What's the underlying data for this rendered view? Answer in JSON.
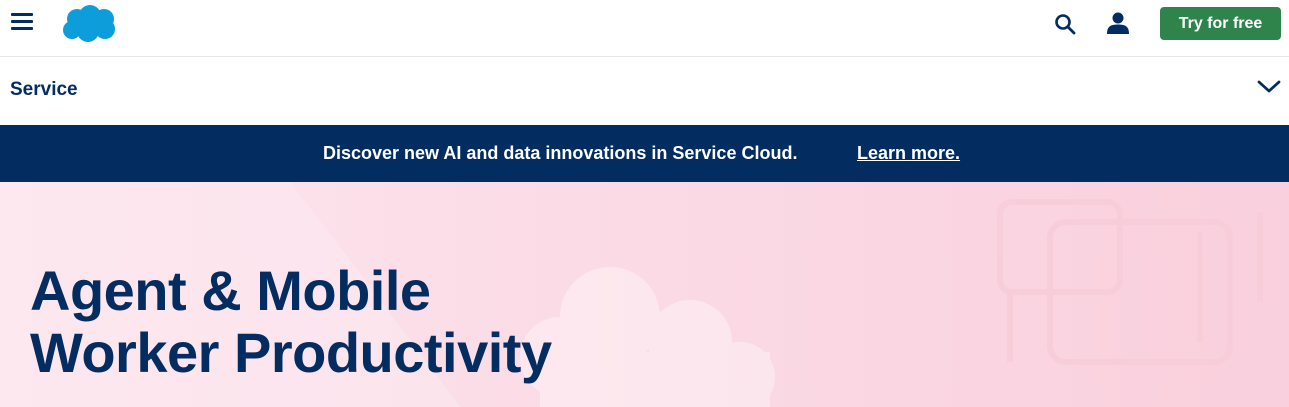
{
  "header": {
    "menu_icon": "hamburger-menu-icon",
    "logo_icon": "salesforce-cloud-logo",
    "search_icon": "search-icon",
    "user_icon": "user-icon",
    "cta_label": "Try for free",
    "cta_color": "#2e844a"
  },
  "subnav": {
    "title": "Service",
    "toggle_icon": "chevron-down-icon"
  },
  "banner": {
    "text": "Discover new AI and data innovations in Service Cloud.",
    "link_label": "Learn more.",
    "background": "#032d60"
  },
  "hero": {
    "title_line1": "Agent & Mobile",
    "title_line2": "Worker Productivity",
    "background": "#fbdbe6",
    "title_color": "#032d60"
  }
}
